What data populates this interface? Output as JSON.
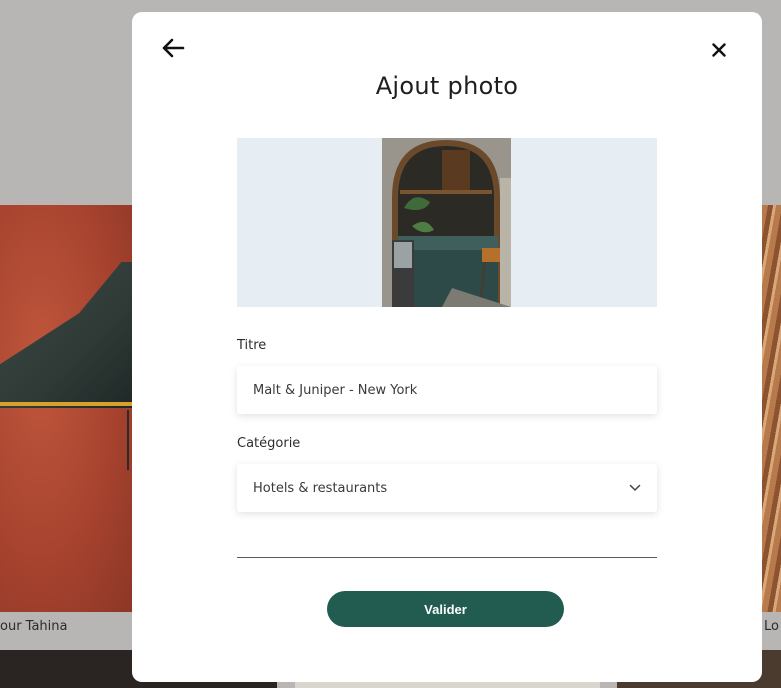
{
  "background": {
    "caption_left": "our Tahina",
    "caption_right": "Lo"
  },
  "modal": {
    "title": "Ajout photo",
    "back_icon": "arrow-left-icon",
    "close_icon": "close-icon",
    "fields": {
      "title_label": "Titre",
      "title_value": "Malt & Juniper - New York",
      "category_label": "Catégorie",
      "category_value": "Hotels & restaurants"
    },
    "submit_label": "Valider"
  },
  "colors": {
    "accent": "#225c50",
    "preview_bg": "#e7eef3"
  }
}
